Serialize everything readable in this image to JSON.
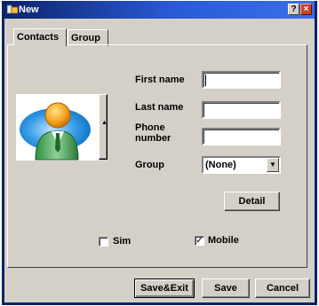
{
  "window": {
    "title": "New",
    "help_glyph": "?",
    "close_glyph": "×"
  },
  "tabs": [
    {
      "label": "Contacts",
      "active": true
    },
    {
      "label": "Group",
      "active": false
    }
  ],
  "form": {
    "first_name_label": "First name",
    "first_name_value": "",
    "last_name_label": "Last name",
    "last_name_value": "",
    "phone_label_line1": "Phone",
    "phone_label_line2": "number",
    "phone_value": "",
    "group_label": "Group",
    "group_value": "(None)",
    "detail_label": "Detail"
  },
  "storage": {
    "sim_label": "Sim",
    "sim_checked": false,
    "mobile_label": "Mobile",
    "mobile_checked": true,
    "check_glyph": "✓"
  },
  "buttons": {
    "save_exit": "Save&Exit",
    "save": "Save",
    "cancel": "Cancel"
  },
  "icons": {
    "contact_photo": "person-icon",
    "dropdown": "chevron-down-icon",
    "scroll": "scroll-up-icon"
  },
  "colors": {
    "title_bar": "#0a246a",
    "window_bg": "#d4d0c8",
    "photo_person": "#f2a41c",
    "photo_tie": "#2a8a3a",
    "photo_bg": "#1f8ddc"
  }
}
